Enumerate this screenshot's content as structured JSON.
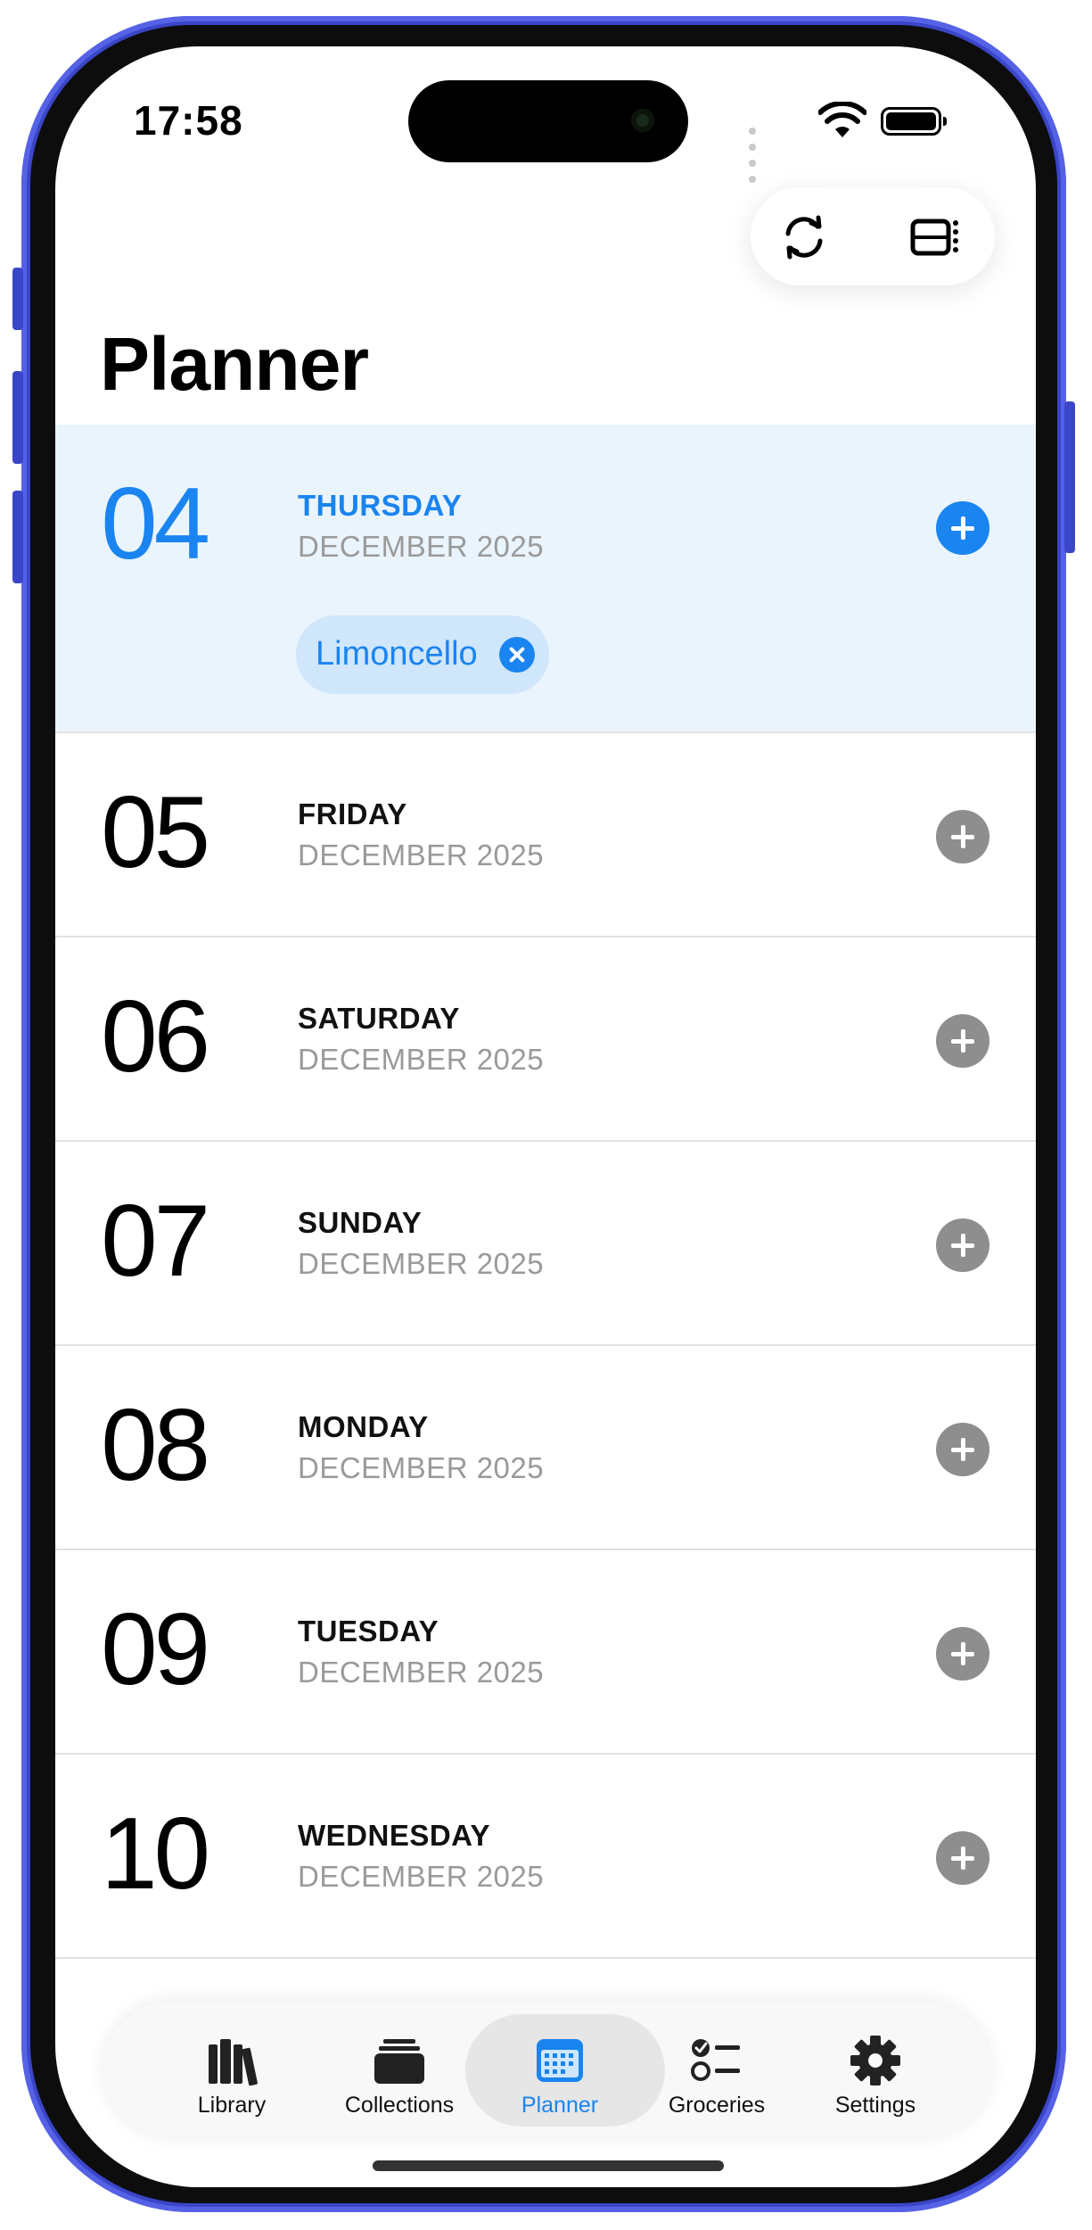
{
  "status_bar": {
    "time": "17:58"
  },
  "header": {
    "title": "Planner"
  },
  "days": [
    {
      "number": "04",
      "weekday": "THURSDAY",
      "month": "DECEMBER 2025",
      "today": true,
      "meals": [
        "Limoncello"
      ]
    },
    {
      "number": "05",
      "weekday": "FRIDAY",
      "month": "DECEMBER 2025",
      "today": false,
      "meals": []
    },
    {
      "number": "06",
      "weekday": "SATURDAY",
      "month": "DECEMBER 2025",
      "today": false,
      "meals": []
    },
    {
      "number": "07",
      "weekday": "SUNDAY",
      "month": "DECEMBER 2025",
      "today": false,
      "meals": []
    },
    {
      "number": "08",
      "weekday": "MONDAY",
      "month": "DECEMBER 2025",
      "today": false,
      "meals": []
    },
    {
      "number": "09",
      "weekday": "TUESDAY",
      "month": "DECEMBER 2025",
      "today": false,
      "meals": []
    },
    {
      "number": "10",
      "weekday": "WEDNESDAY",
      "month": "DECEMBER 2025",
      "today": false,
      "meals": []
    }
  ],
  "tab_bar": {
    "selected": "Planner",
    "tabs": [
      {
        "label": "Library",
        "icon": "books-icon"
      },
      {
        "label": "Collections",
        "icon": "collections-icon"
      },
      {
        "label": "Planner",
        "icon": "calendar-icon"
      },
      {
        "label": "Groceries",
        "icon": "checklist-icon"
      },
      {
        "label": "Settings",
        "icon": "gear-icon"
      }
    ]
  },
  "colors": {
    "accent": "#1a84f0",
    "today_background": "#eaf4fd",
    "chip_background": "#cfe6fb",
    "secondary_text": "#9a9a9a",
    "add_button_inactive": "#8e8e8e",
    "device_frame": "#3a46c8"
  }
}
